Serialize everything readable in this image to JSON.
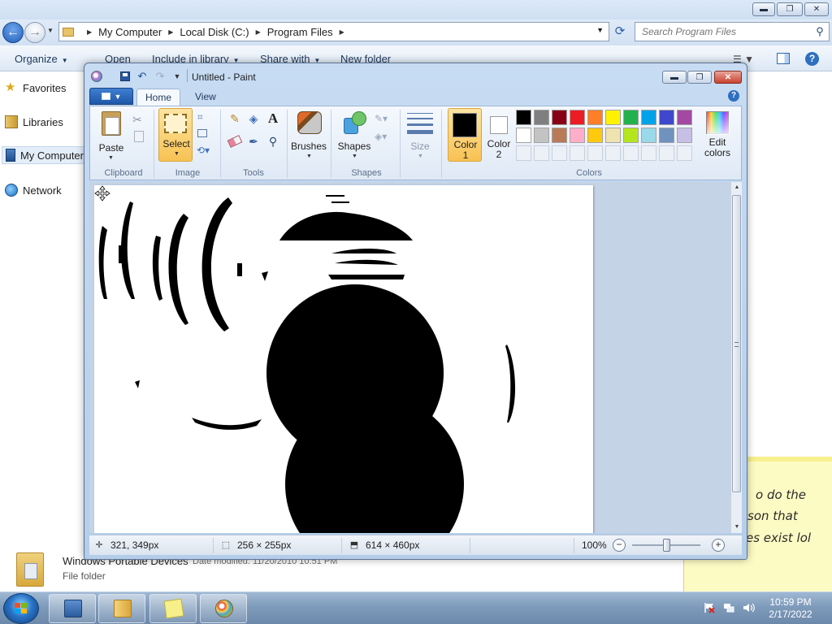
{
  "explorer": {
    "window_buttons": {
      "minimize": "▬",
      "maximize": "❐",
      "close": "✕"
    },
    "breadcrumbs": [
      "My Computer",
      "Local Disk (C:)",
      "Program Files"
    ],
    "search": {
      "placeholder": "Search Program Files"
    },
    "toolbar": {
      "organize": "Organize",
      "open": "Open",
      "include_in_library": "Include in library",
      "share_with": "Share with",
      "new_folder": "New folder"
    },
    "nav_pane": [
      {
        "label": "Favorites",
        "icon": "star-icon"
      },
      {
        "label": "Libraries",
        "icon": "library-icon"
      },
      {
        "label": "My Computer",
        "icon": "computer-icon",
        "selected": true
      },
      {
        "label": "Network",
        "icon": "network-icon"
      }
    ],
    "file": {
      "name": "Windows Portable Devices",
      "modified": "Date modified: 11/20/2010 10:51 PM",
      "type": "File folder"
    }
  },
  "sticky_note": {
    "lines": [
      "o do the",
      "son that",
      "es exist lol"
    ]
  },
  "paint": {
    "title": "Untitled - Paint",
    "tabs": {
      "home": "Home",
      "view": "View"
    },
    "groups": {
      "clipboard": "Clipboard",
      "image": "Image",
      "tools": "Tools",
      "shapes": "Shapes",
      "colors": "Colors"
    },
    "buttons": {
      "paste": "Paste",
      "select": "Select",
      "brushes": "Brushes",
      "shapes": "Shapes",
      "size": "Size",
      "color1_line1": "Color",
      "color1_line2": "1",
      "color2_line1": "Color",
      "color2_line2": "2",
      "edit_colors_line1": "Edit",
      "edit_colors_line2": "colors"
    },
    "active_color1": "#000000",
    "active_color2": "#ffffff",
    "palette_row1": [
      "#000000",
      "#7f7f7f",
      "#880015",
      "#ed1c24",
      "#ff7f27",
      "#fff200",
      "#22b14c",
      "#00a2e8",
      "#3f48cc",
      "#a349a4"
    ],
    "palette_row2": [
      "#ffffff",
      "#c3c3c3",
      "#b97a57",
      "#ffaec9",
      "#ffc90e",
      "#efe4b0",
      "#b5e61d",
      "#99d9ea",
      "#7092be",
      "#c8bfe7"
    ],
    "status": {
      "cursor_pos": "321, 349px",
      "selection_size": "256 × 255px",
      "canvas_size": "614 × 460px",
      "zoom": "100%"
    }
  },
  "taskbar": {
    "apps": [
      "Windows Explorer",
      "Libraries",
      "Sticky Notes",
      "Paint"
    ],
    "clock_time": "10:59 PM",
    "clock_date": "2/17/2022"
  }
}
